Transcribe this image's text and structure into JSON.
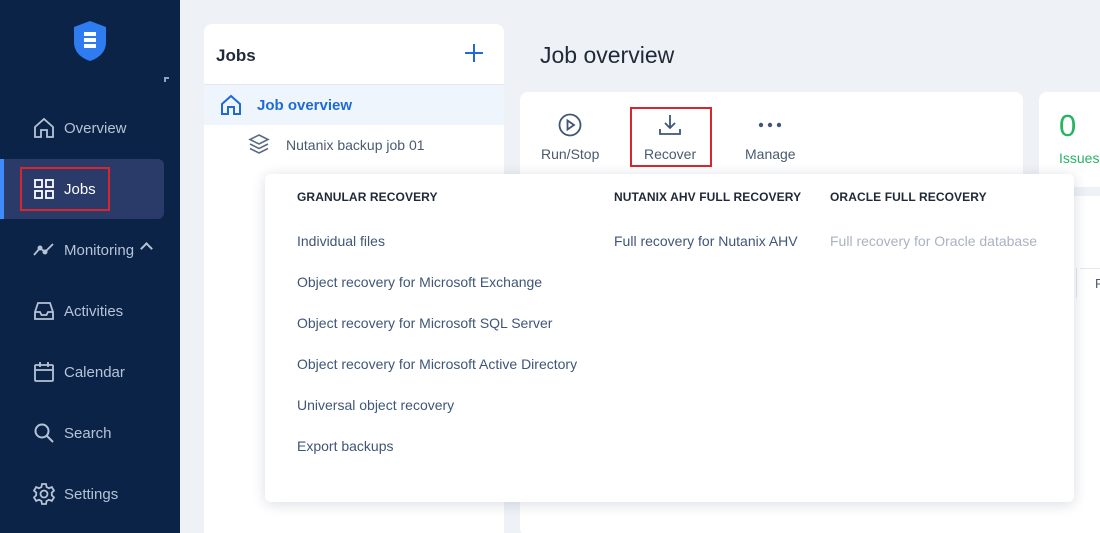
{
  "sidebar": {
    "items": [
      {
        "label": "Overview",
        "icon": "home-icon"
      },
      {
        "label": "Jobs",
        "icon": "grid-icon",
        "active": true
      },
      {
        "label": "Monitoring",
        "icon": "chart-line-icon",
        "expandable": true
      },
      {
        "label": "Activities",
        "icon": "inbox-icon"
      },
      {
        "label": "Calendar",
        "icon": "calendar-icon"
      },
      {
        "label": "Search",
        "icon": "search-icon"
      },
      {
        "label": "Settings",
        "icon": "gear-icon"
      }
    ]
  },
  "jobs_panel": {
    "title": "Jobs",
    "tree": [
      {
        "label": "Job overview",
        "selected": true
      },
      {
        "label": "Nutanix backup job 01"
      }
    ]
  },
  "main": {
    "title": "Job overview",
    "toolbar": {
      "run_stop": "Run/Stop",
      "recover": "Recover",
      "manage": "Manage"
    },
    "issues": {
      "count": "0",
      "label": "Issues"
    },
    "table_fragment": "F"
  },
  "recover_menu": {
    "granular": {
      "heading": "GRANULAR RECOVERY",
      "items": [
        "Individual files",
        "Object recovery for Microsoft Exchange",
        "Object recovery for Microsoft SQL Server",
        "Object recovery for Microsoft Active Directory",
        "Universal object recovery",
        "Export backups"
      ]
    },
    "nutanix": {
      "heading": "NUTANIX AHV FULL RECOVERY",
      "items": [
        "Full recovery for Nutanix AHV"
      ]
    },
    "oracle": {
      "heading": "ORACLE FULL RECOVERY",
      "items": [
        "Full recovery for Oracle database"
      ]
    }
  },
  "colors": {
    "sidebar_bg": "#0a2347",
    "accent_blue": "#1e6bd6",
    "issues_green": "#28b463",
    "highlight_red": "#d8262f"
  }
}
